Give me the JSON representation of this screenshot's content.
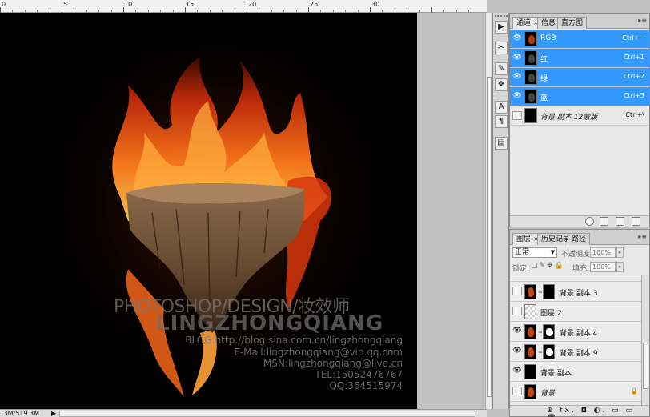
{
  "ruler": {
    "labels": [
      "0",
      "5",
      "10",
      "15",
      "20",
      "25",
      "30"
    ]
  },
  "status": {
    "doc_size": ".3M/519.3M",
    "arrow": "▶"
  },
  "watermark": {
    "line1": "PHOTOSHOP/DESIGN/妆效师",
    "line2": "LINGZHONGQIANG",
    "blog": "BLOG:http://blog.sina.com.cn/lingzhongqiang",
    "email": "E-Mail:lingzhongqiang@vip.qq.com",
    "msn": "MSN:lingzhongqiang@live.cn",
    "tel": "TEL:15052476767",
    "qq": "QQ:364515974"
  },
  "channels_panel": {
    "tabs": [
      {
        "label": "通道",
        "close": "×"
      },
      {
        "label": "信息"
      },
      {
        "label": "直方图"
      }
    ],
    "menu": "▸≡",
    "rows": [
      {
        "name": "RGB",
        "key": "Ctrl+~",
        "selected": true
      },
      {
        "name": "红",
        "key": "Ctrl+1",
        "selected": true
      },
      {
        "name": "绿",
        "key": "Ctrl+2",
        "selected": true
      },
      {
        "name": "蓝",
        "key": "Ctrl+3",
        "selected": true
      },
      {
        "name": "背景 副本 12蒙版",
        "key": "Ctrl+\\",
        "selected": false
      }
    ]
  },
  "layers_panel": {
    "tabs": [
      {
        "label": "图层",
        "close": "×"
      },
      {
        "label": "历史记录"
      },
      {
        "label": "路径"
      }
    ],
    "menu": "▸≡",
    "blend_mode": "正常",
    "opacity_label": "不透明度:",
    "opacity_value": "100%",
    "lock_label": "锁定:",
    "fill_label": "填充:",
    "fill_value": "100%",
    "rows": [
      {
        "name": "背景 副本 3",
        "mask": true
      },
      {
        "name": "图层 2",
        "transparent": true
      },
      {
        "name": "背景 副本 4",
        "mask": true
      },
      {
        "name": "背景 副本 9",
        "mask": true
      },
      {
        "name": "背景 副本",
        "black": true
      },
      {
        "name": "背景",
        "italic": true,
        "lock": "🔒"
      }
    ],
    "footer": "⊕ fx. ◘ ◐. ▭ ▭ 🗑"
  },
  "colors": {
    "selection": "#3399ff",
    "panel_bg": "#e8e8e8"
  }
}
